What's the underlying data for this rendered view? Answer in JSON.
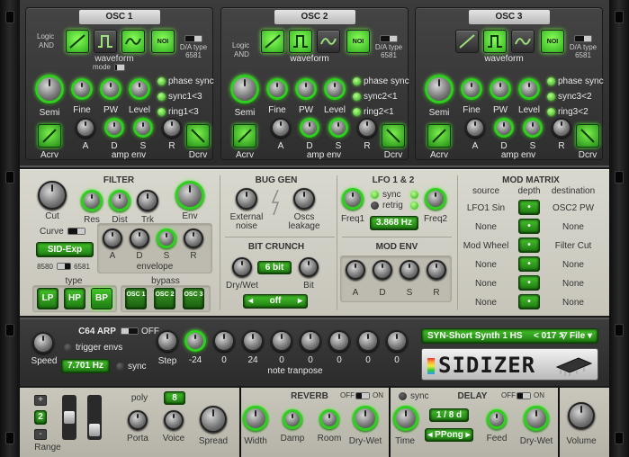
{
  "osc": [
    {
      "title": "OSC 1",
      "logic": "Logic",
      "and": "AND",
      "noi": "NOI",
      "waveform": "waveform",
      "mode": "mode",
      "da_type": "D/A type",
      "da_value": "6581",
      "semi": "Semi",
      "fine": "Fine",
      "pw": "PW",
      "level": "Level",
      "led1": "phase sync",
      "led2": "sync1<3",
      "led3": "ring1<3",
      "acrv": "Acrv",
      "dcrv": "Dcrv",
      "a": "A",
      "d": "D",
      "s": "S",
      "r": "R",
      "amp_env": "amp env"
    },
    {
      "title": "OSC 2",
      "logic": "Logic",
      "and": "AND",
      "noi": "NOI",
      "waveform": "waveform",
      "mode": "",
      "da_type": "D/A type",
      "da_value": "6581",
      "semi": "Semi",
      "fine": "Fine",
      "pw": "PW",
      "level": "Level",
      "led1": "phase sync",
      "led2": "sync2<1",
      "led3": "ring2<1",
      "acrv": "Acrv",
      "dcrv": "Dcrv",
      "a": "A",
      "d": "D",
      "s": "S",
      "r": "R",
      "amp_env": "amp env"
    },
    {
      "title": "OSC 3",
      "logic": "",
      "and": "",
      "noi": "NOI",
      "waveform": "waveform",
      "mode": "",
      "da_type": "D/A type",
      "da_value": "6581",
      "semi": "Semi",
      "fine": "Fine",
      "pw": "PW",
      "level": "Level",
      "led1": "phase sync",
      "led2": "sync3<2",
      "led3": "ring3<2",
      "acrv": "Acrv",
      "dcrv": "Dcrv",
      "a": "A",
      "d": "D",
      "s": "S",
      "r": "R",
      "amp_env": "amp env"
    }
  ],
  "filter": {
    "title": "FILTER",
    "cut": "Cut",
    "curve": "Curve",
    "res": "Res",
    "dist": "Dist",
    "trk": "Trk",
    "env": "Env",
    "model": "SID-Exp",
    "chip_a": "8580",
    "chip_b": "6581",
    "a": "A",
    "d": "D",
    "s": "S",
    "r": "R",
    "envelope": "envelope",
    "type": "type",
    "lp": "LP",
    "hp": "HP",
    "bp": "BP",
    "bypass": "bypass",
    "osc1": "OSC 1",
    "osc2": "OSC 2",
    "osc3": "OSC 3"
  },
  "bug_gen": {
    "title": "BUG GEN",
    "external": "External",
    "noise": "noise",
    "oscs": "Oscs",
    "leakage": "leakage"
  },
  "bit_crunch": {
    "title": "BIT CRUNCH",
    "dry_wet": "Dry/Wet",
    "bits_value": "6 bit",
    "bit": "Bit",
    "mode_value": "off"
  },
  "lfo": {
    "title": "LFO 1 & 2",
    "sync": "sync",
    "retrig": "retrig",
    "freq1": "Freq1",
    "freq2": "Freq2",
    "rate_value": "3.868 Hz"
  },
  "mod_env": {
    "title": "MOD ENV",
    "a": "A",
    "d": "D",
    "s": "S",
    "r": "R"
  },
  "mod_matrix": {
    "title": "MOD MATRIX",
    "h_source": "source",
    "h_depth": "depth",
    "h_destination": "destination",
    "rows": [
      {
        "source": "LFO1 Sin",
        "destination": "OSC2 PW"
      },
      {
        "source": "None",
        "destination": "None"
      },
      {
        "source": "Mod Wheel",
        "destination": "Filter Cut"
      },
      {
        "source": "None",
        "destination": "None"
      },
      {
        "source": "None",
        "destination": "None"
      },
      {
        "source": "None",
        "destination": "None"
      }
    ]
  },
  "arp": {
    "title": "C64 ARP",
    "off": "OFF",
    "speed": "Speed",
    "trigger_envs": "trigger envs",
    "rate_value": "7.701 Hz",
    "sync": "sync",
    "step": "Step",
    "transpose": [
      "-24",
      "0",
      "24",
      "0",
      "0",
      "0",
      "0",
      "0"
    ],
    "note_transpose": "note tranpose"
  },
  "preset": {
    "name": "SYN-Short Synth 1 HS",
    "number": "< 017 >",
    "file": "▽ File ▾"
  },
  "logo": "SIDIZER",
  "voice": {
    "plus": "+",
    "minus": "-",
    "range_value": "2",
    "range": "Range",
    "poly": "poly",
    "voice_count": "8",
    "porta": "Porta",
    "voice": "Voice",
    "spread": "Spread"
  },
  "reverb": {
    "title": "REVERB",
    "off": "OFF",
    "on": "ON",
    "width": "Width",
    "damp": "Damp",
    "room": "Room",
    "dry_wet": "Dry-Wet"
  },
  "delay": {
    "title": "DELAY",
    "sync": "sync",
    "off": "OFF",
    "on": "ON",
    "time_value": "1 / 8 d",
    "mode_value": "PPong",
    "time": "Time",
    "feed": "Feed",
    "dry_wet": "Dry-Wet"
  },
  "volume": "Volume",
  "colors": {
    "accent_green": "#2fcf20",
    "lcd_green": "#44c42a",
    "panel_dark": "#333333",
    "panel_light": "#d0cec4"
  }
}
